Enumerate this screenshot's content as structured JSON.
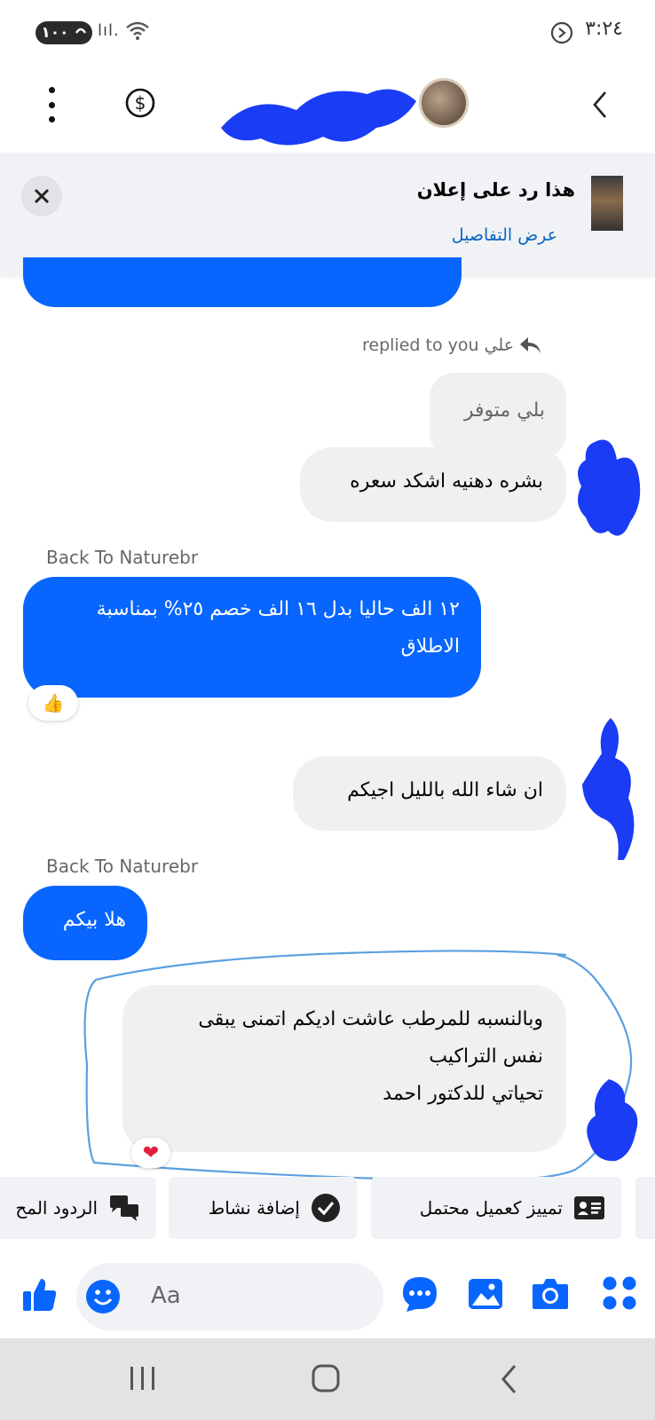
{
  "status_bar": {
    "battery": "١٠٠",
    "clock": "٣:٢٤"
  },
  "header": {
    "icons": [
      "menu-dots-icon",
      "dollar-icon",
      "back-chevron-icon"
    ]
  },
  "ad_banner": {
    "title": "هذا رد على إعلان",
    "link": "عرض التفاصيل"
  },
  "chat": {
    "reply_label": "replied to you علي",
    "quoted_text": "بلي متوفر",
    "messages": [
      {
        "id": "m1",
        "text": "بشره دهنيه اشكد سعره"
      },
      {
        "id": "m2",
        "sender": "Back To Naturebr",
        "text": "١٢ الف حاليا بدل ١٦ الف خصم ٢٥% بمناسبة الاطلاق",
        "reaction": "👍"
      },
      {
        "id": "m3",
        "text": "ان شاء الله بالليل اجيكم"
      },
      {
        "id": "m4",
        "sender": "Back To Naturebr",
        "text": "هلا بيكم"
      },
      {
        "id": "m5",
        "lines": [
          "وبالنسبه للمرطب عاشت اديكم اتمنى يبقى",
          "نفس التراكيب",
          "تحياتي للدكتور احمد"
        ],
        "reaction": "❤"
      }
    ]
  },
  "quick_actions": [
    {
      "label": "الردود المح",
      "icon": "chat-bubbles-icon"
    },
    {
      "label": "إضافة نشاط",
      "icon": "check-circle-icon"
    },
    {
      "label": "تمييز كعميل محتمل",
      "icon": "contact-card-icon"
    }
  ],
  "composer": {
    "placeholder": "Aa"
  },
  "colors": {
    "accent": "#0866ff",
    "bubble_out": "#f0f0f0",
    "annotation": "#5aa0e0"
  }
}
